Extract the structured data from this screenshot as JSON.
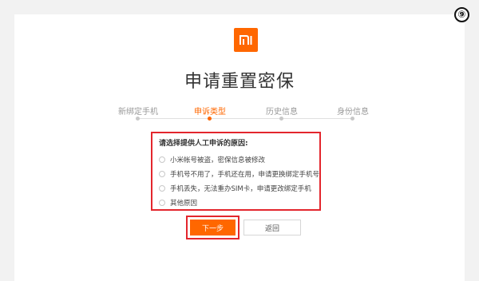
{
  "annotation": {
    "step_badge": "⑨"
  },
  "brand": {
    "logo_text": "mi",
    "color": "#ff6700"
  },
  "page": {
    "title": "申请重置密保"
  },
  "steps": [
    {
      "label": "新绑定手机",
      "active": false
    },
    {
      "label": "申诉类型",
      "active": true
    },
    {
      "label": "历史信息",
      "active": false
    },
    {
      "label": "身份信息",
      "active": false
    }
  ],
  "reason": {
    "heading": "请选择提供人工申诉的原因:",
    "options": [
      "小米帐号被盗，密保信息被修改",
      "手机号不用了，手机还在用，申请更换绑定手机号",
      "手机丢失，无法重办SIM卡，申请更改绑定手机",
      "其他原因"
    ]
  },
  "buttons": {
    "next": "下一步",
    "back": "返回"
  },
  "colors": {
    "accent": "#ff6700",
    "highlight": "#e3262d"
  }
}
